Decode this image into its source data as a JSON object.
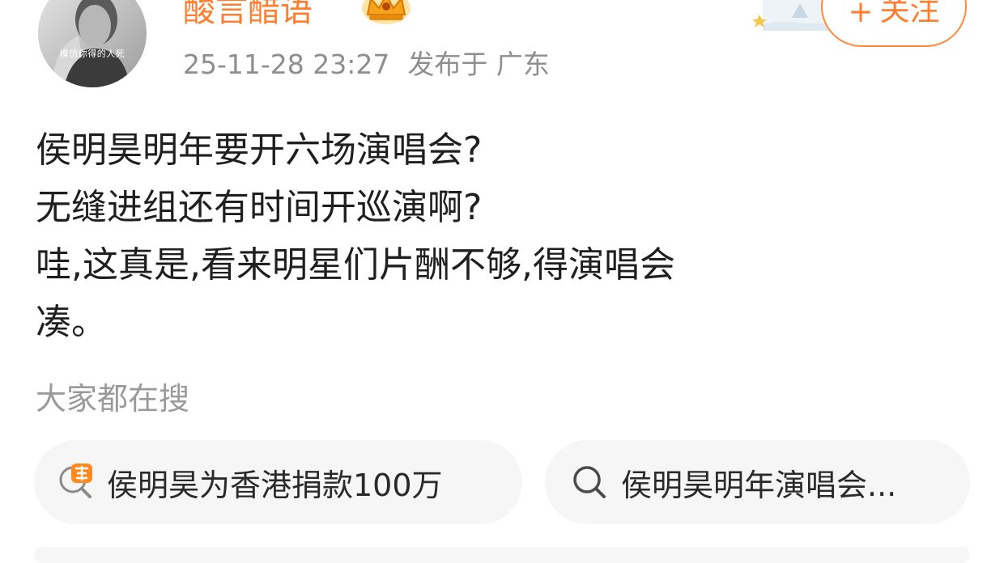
{
  "author": {
    "name": "酸言醋语",
    "avatar_caption": "模仿你得的人死",
    "post_time": "25-11-28 23:27",
    "location": "发布于 广东"
  },
  "follow_button": {
    "plus": "+",
    "label": "关注"
  },
  "post": {
    "lines": [
      "侯明昊明年要开六场演唱会?",
      "无缝进组还有时间开巡演啊?",
      "哇,这真是,看来明星们片酬不够,得演唱会",
      "凑。"
    ]
  },
  "search_section": {
    "label": "大家都在搜",
    "items": [
      {
        "text": "侯明昊为香港捐款100万",
        "icon": "hot-search-icon"
      },
      {
        "text": "侯明昊明年演唱会...",
        "icon": "search-icon"
      }
    ]
  },
  "colors": {
    "accent": "#ff7d2e",
    "meta_text": "#8e8e8e",
    "chip_background": "#f6f6f6"
  }
}
